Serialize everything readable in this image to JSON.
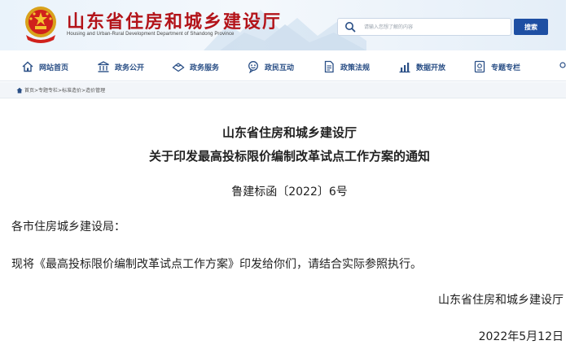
{
  "header": {
    "site_title": "山东省住房和城乡建设厅",
    "site_subtitle": "Housing and Urban-Rural Development Department of Shandong Province",
    "search_placeholder": "请输入您想了解的内容",
    "search_button": "搜索",
    "colors": {
      "title": "#b3141a",
      "search_button": "#1e4fa3",
      "nav_text": "#2a4f86"
    }
  },
  "nav": {
    "items": [
      {
        "label": "网站首页",
        "icon": "home-icon"
      },
      {
        "label": "政务公开",
        "icon": "building-icon"
      },
      {
        "label": "政务服务",
        "icon": "service-icon"
      },
      {
        "label": "政民互动",
        "icon": "interaction-icon"
      },
      {
        "label": "政策法规",
        "icon": "document-icon"
      },
      {
        "label": "数据开放",
        "icon": "chart-icon"
      },
      {
        "label": "专题专栏",
        "icon": "topic-icon"
      }
    ]
  },
  "breadcrumb": {
    "text": "首页>专题专栏>标准造价>造价管理"
  },
  "article": {
    "title_line1": "山东省住房和城乡建设厅",
    "title_line2": "关于印发最高投标限价编制改革试点工作方案的通知",
    "doc_number": "鲁建标函〔2022〕6号",
    "salutation": "各市住房城乡建设局：",
    "body": "现将《最高投标限价编制改革试点工作方案》印发给你们，请结合实际参照执行。",
    "issuer": "山东省住房和城乡建设厅",
    "date": "2022年5月12日"
  }
}
